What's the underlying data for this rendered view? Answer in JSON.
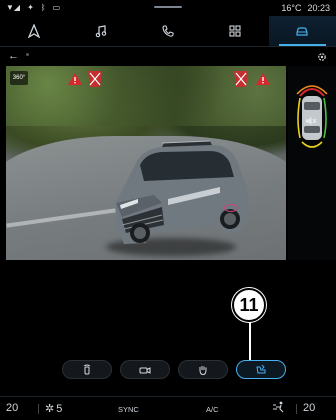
{
  "status": {
    "left_icons": [
      "signal-icon",
      "location-icon",
      "bluetooth-icon",
      "message-icon"
    ],
    "temperature": "16°C",
    "time": "20:23"
  },
  "nav": {
    "items": [
      {
        "icon": "navigation-icon"
      },
      {
        "icon": "music-icon"
      },
      {
        "icon": "phone-icon"
      },
      {
        "icon": "apps-grid-icon"
      },
      {
        "icon": "car-icon",
        "active": true
      }
    ]
  },
  "camera": {
    "view_badge": "360°",
    "warning_count": 2
  },
  "controls": {
    "buttons": [
      {
        "icon": "parking-sensor-icon"
      },
      {
        "icon": "camera-icon"
      },
      {
        "icon": "hand-gesture-icon"
      },
      {
        "icon": "auto-park-icon",
        "active": true
      }
    ]
  },
  "callout": {
    "number": "11"
  },
  "climate": {
    "left_temp": "20",
    "fan_level": "5",
    "sync_label": "SYNC",
    "ac_label": "A/C",
    "right_temp": "20"
  },
  "colors": {
    "accent": "#46b2ee",
    "warning": "#d8262e"
  }
}
